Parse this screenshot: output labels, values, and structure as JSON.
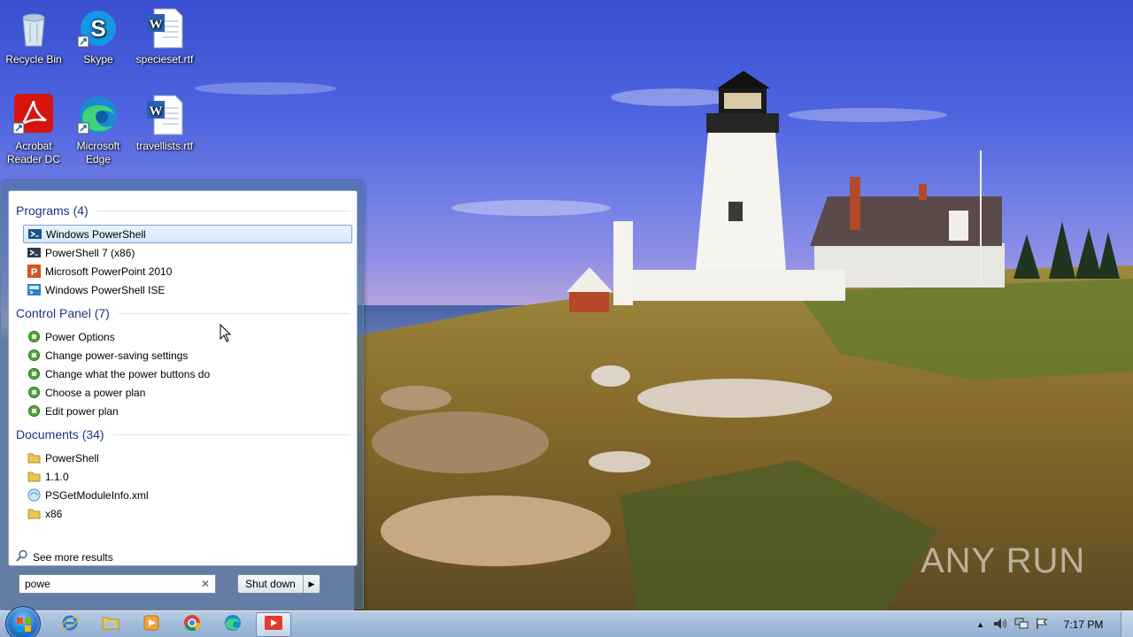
{
  "desktop": {
    "icons": [
      {
        "label": "Recycle Bin",
        "icon": "recycle-bin-icon"
      },
      {
        "label": "Skype",
        "icon": "skype-icon"
      },
      {
        "label": "specieset.rtf",
        "icon": "word-document-icon"
      },
      {
        "label": "Acrobat Reader DC",
        "icon": "acrobat-icon"
      },
      {
        "label": "Microsoft Edge",
        "icon": "edge-icon"
      },
      {
        "label": "travellists.rtf",
        "icon": "word-document-icon"
      }
    ],
    "watermark": "ANY RUN"
  },
  "start_menu": {
    "sections": [
      {
        "title": "Programs (4)",
        "items": [
          {
            "label": "Windows PowerShell",
            "icon": "powershell-icon",
            "selected": true
          },
          {
            "label": "PowerShell 7 (x86)",
            "icon": "powershell7-icon"
          },
          {
            "label": "Microsoft PowerPoint 2010",
            "icon": "powerpoint-icon"
          },
          {
            "label": "Windows PowerShell ISE",
            "icon": "powershell-ise-icon"
          }
        ]
      },
      {
        "title": "Control Panel (7)",
        "items": [
          {
            "label": "Power Options",
            "icon": "power-options-icon"
          },
          {
            "label": "Change power-saving settings",
            "icon": "power-options-icon"
          },
          {
            "label": "Change what the power buttons do",
            "icon": "power-options-icon"
          },
          {
            "label": "Choose a power plan",
            "icon": "power-options-icon"
          },
          {
            "label": "Edit power plan",
            "icon": "power-options-icon"
          }
        ]
      },
      {
        "title": "Documents (34)",
        "items": [
          {
            "label": "PowerShell",
            "icon": "folder-icon"
          },
          {
            "label": "1.1.0",
            "icon": "folder-icon"
          },
          {
            "label": "PSGetModuleInfo.xml",
            "icon": "xml-file-icon"
          },
          {
            "label": "x86",
            "icon": "folder-icon"
          }
        ]
      }
    ],
    "see_more": "See more results",
    "search_value": "powe",
    "shutdown_label": "Shut down"
  },
  "taskbar": {
    "pinned": [
      "internet-explorer-icon",
      "file-explorer-icon",
      "media-player-icon",
      "chrome-icon",
      "edge-icon",
      "anyrun-icon"
    ],
    "clock": "7:17 PM"
  },
  "colors": {
    "section_title": "#1e3287",
    "selection_border": "#7da2ce",
    "taskbar": "#a6bfdc"
  }
}
